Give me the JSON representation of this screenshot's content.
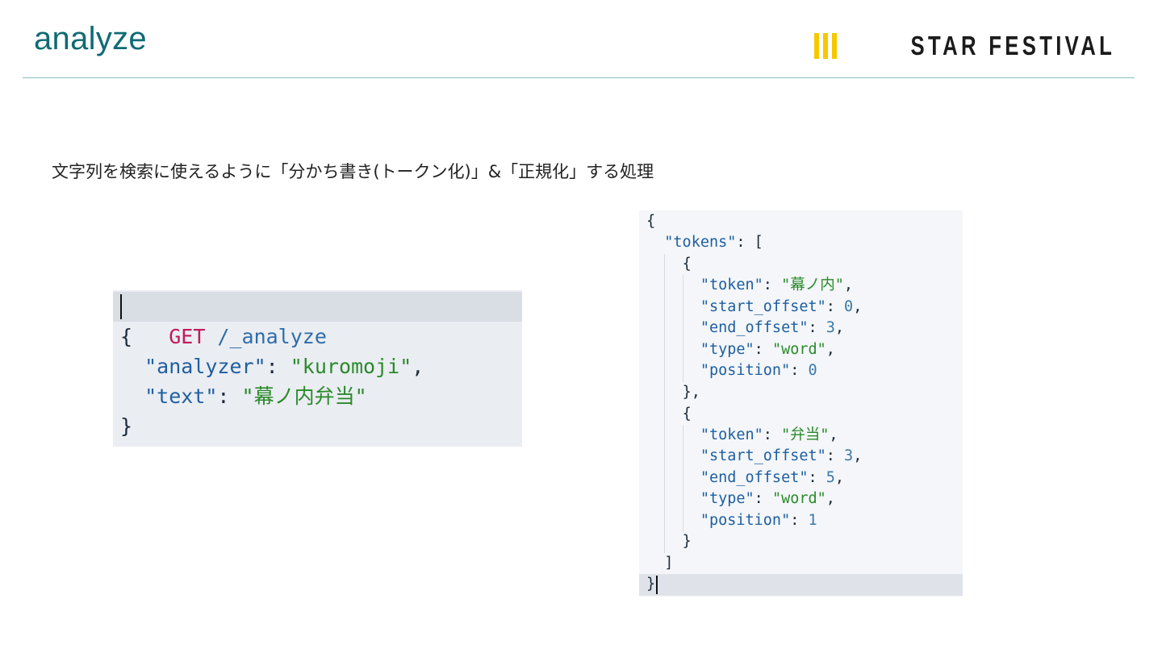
{
  "slide": {
    "title": "analyze",
    "subtitle": "文字列を検索に使えるように「分かち書き(トークン化)」&「正規化」する処理"
  },
  "brand": {
    "name": "STAR FESTIVAL",
    "mark_color": "#f5c800"
  },
  "colors": {
    "title": "#0f6b73",
    "rule": "#8bbcc0",
    "method": "#c2185b",
    "key": "#1f5fa0",
    "string": "#2a8a2a",
    "number": "#3b79a8"
  },
  "request": {
    "method": "GET",
    "path": " /_analyze",
    "open_brace": "{",
    "analyzer_key": "\"analyzer\"",
    "analyzer_value": "\"kuromoji\"",
    "text_key": "\"text\"",
    "text_value": "\"幕ノ内弁当\"",
    "close_brace": "}"
  },
  "response": {
    "open_brace": "{",
    "tokens_key": "\"tokens\"",
    "tokens_open": "[",
    "tokens_close": "]",
    "close_brace": "}",
    "tokens": [
      {
        "token": "\"幕ノ内\"",
        "start_offset": "0",
        "end_offset": "3",
        "type": "\"word\"",
        "position": "0",
        "close": "},"
      },
      {
        "token": "\"弁当\"",
        "start_offset": "3",
        "end_offset": "5",
        "type": "\"word\"",
        "position": "1",
        "close": "}"
      }
    ],
    "field_names": {
      "token": "\"token\"",
      "start_offset": "\"start_offset\"",
      "end_offset": "\"end_offset\"",
      "type": "\"type\"",
      "position": "\"position\""
    }
  }
}
